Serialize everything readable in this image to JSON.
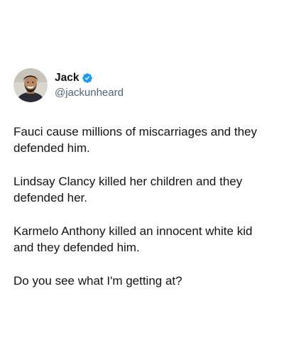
{
  "author": {
    "display_name": "Jack",
    "handle": "@jackunheard",
    "verified": true,
    "avatar_icon": "person-avatar-icon",
    "verified_icon": "verified-badge-icon",
    "verified_color": "#1d9bf0"
  },
  "tweet": {
    "paragraphs": [
      "Fauci cause millions of miscarriages and they\ndefended him.",
      "Lindsay Clancy killed her children and they\ndefended her.",
      "Karmelo Anthony killed an innocent white kid\nand they defended him.",
      "Do you see what I'm getting at?"
    ]
  },
  "colors": {
    "text_primary": "#0f1419",
    "text_secondary": "#536471",
    "background": "#ffffff"
  }
}
